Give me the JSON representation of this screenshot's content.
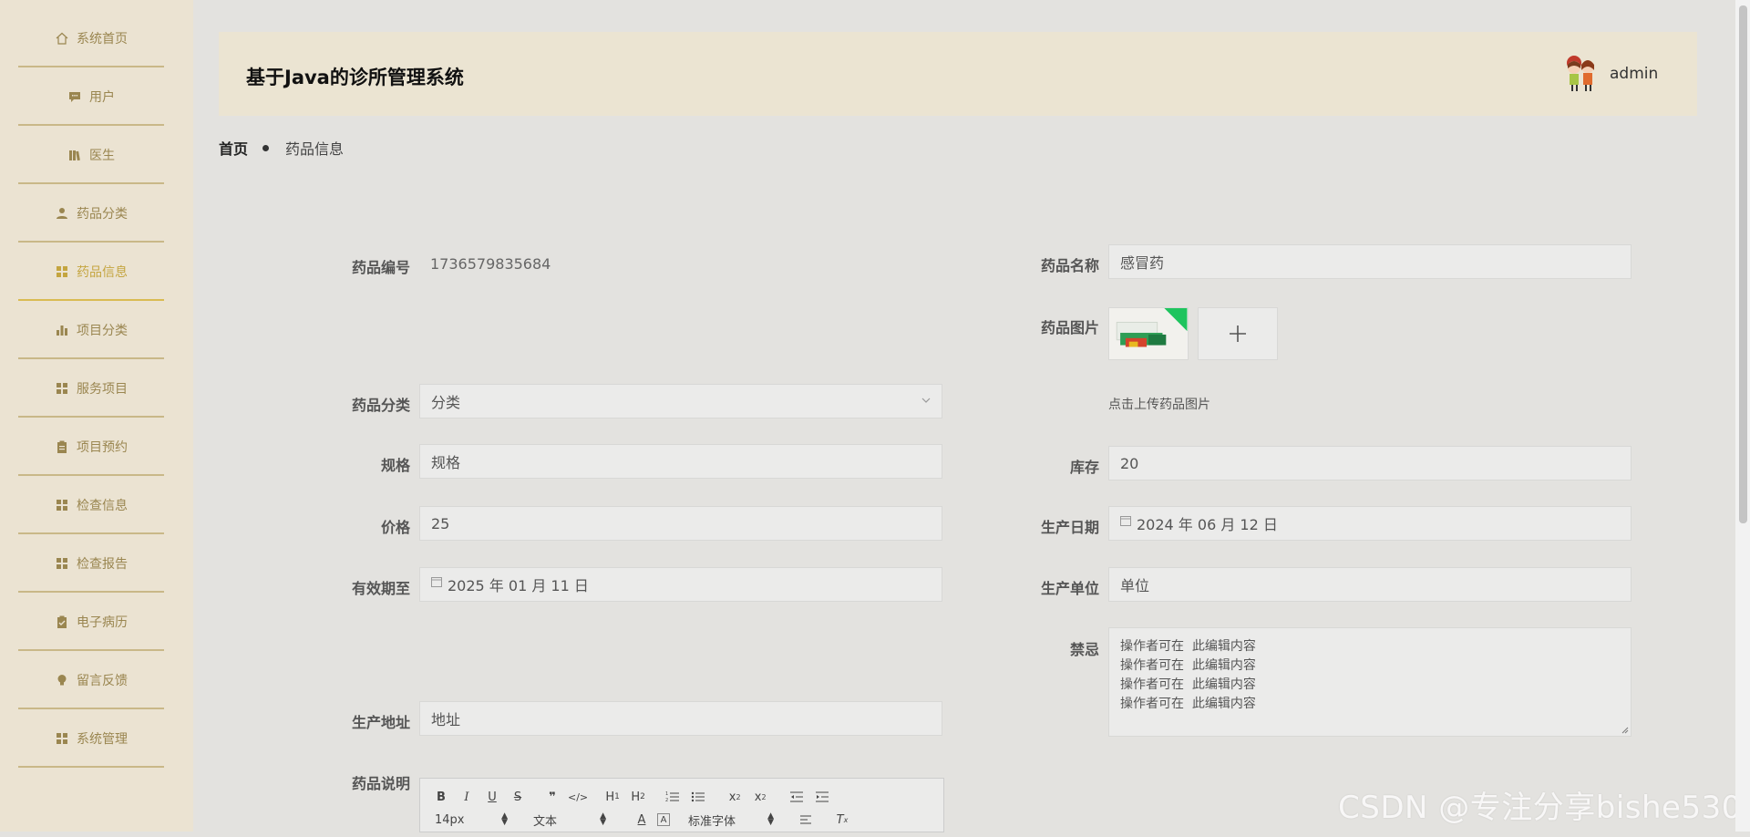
{
  "sidebar": {
    "items": [
      {
        "label": "系统首页",
        "icon": "home-icon"
      },
      {
        "label": "用户",
        "icon": "chat-icon"
      },
      {
        "label": "医生",
        "icon": "book-icon"
      },
      {
        "label": "药品分类",
        "icon": "person-icon"
      },
      {
        "label": "药品信息",
        "icon": "grid-icon",
        "active": true
      },
      {
        "label": "项目分类",
        "icon": "bar-chart-icon"
      },
      {
        "label": "服务项目",
        "icon": "grid-icon"
      },
      {
        "label": "项目预约",
        "icon": "clipboard-icon"
      },
      {
        "label": "检查信息",
        "icon": "grid-icon"
      },
      {
        "label": "检查报告",
        "icon": "grid-icon"
      },
      {
        "label": "电子病历",
        "icon": "clipboard-check-icon"
      },
      {
        "label": "留言反馈",
        "icon": "bulb-icon"
      },
      {
        "label": "系统管理",
        "icon": "grid-icon"
      }
    ]
  },
  "header": {
    "title": "基于Java的诊所管理系统",
    "username": "admin"
  },
  "breadcrumb": {
    "home": "首页",
    "current": "药品信息"
  },
  "form": {
    "code_label": "药品编号",
    "code_value": "1736579835684",
    "name_label": "药品名称",
    "name_value": "感冒药",
    "image_label": "药品图片",
    "upload_hint": "点击上传药品图片",
    "category_label": "药品分类",
    "category_value": "分类",
    "spec_label": "规格",
    "spec_value": "规格",
    "stock_label": "库存",
    "stock_value": "20",
    "price_label": "价格",
    "price_value": "25",
    "prod_date_label": "生产日期",
    "prod_date_value": "2024 年 06 月 12 日",
    "expiry_label": "有效期至",
    "expiry_value": "2025 年 01 月 11 日",
    "maker_label": "生产单位",
    "maker_value": "单位",
    "taboo_label": "禁忌",
    "taboo_lines": [
      "操作者可在  此编辑内容",
      "操作者可在  此编辑内容",
      "操作者可在  此编辑内容",
      "操作者可在  此编辑内容"
    ],
    "address_label": "生产地址",
    "address_value": "地址",
    "desc_label": "药品说明"
  },
  "editor": {
    "font_size": "14px",
    "block_type": "文本",
    "font_family": "标准字体"
  },
  "watermark": "CSDN @专注分享bishe530",
  "colors": {
    "sidebar_bg": "#ebe3d2",
    "accent": "#c4a540",
    "header_bg": "#ebe4d2"
  }
}
